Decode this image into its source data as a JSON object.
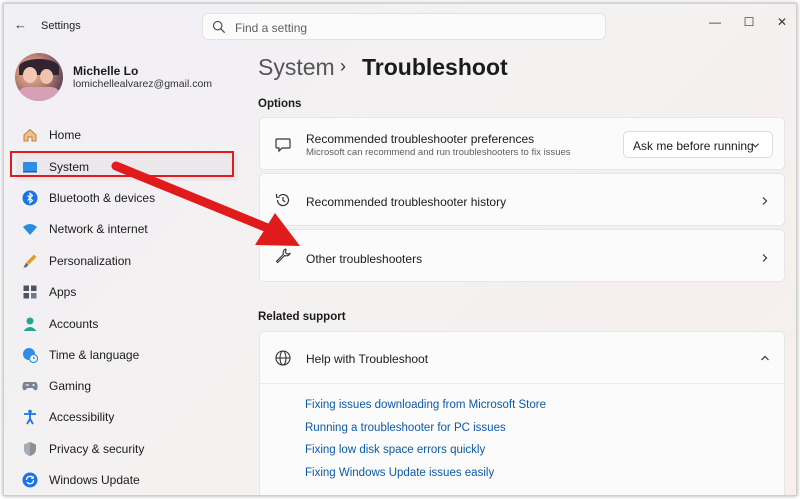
{
  "window": {
    "title": "Settings",
    "minimize_glyph": "—",
    "maximize_glyph": "☐",
    "close_glyph": "✕",
    "back_glyph": "←"
  },
  "search": {
    "placeholder": "Find a setting"
  },
  "profile": {
    "name": "Michelle Lo",
    "email": "lomichellealvarez@gmail.com"
  },
  "sidebar": {
    "items": [
      {
        "label": "Home",
        "icon": "home-icon"
      },
      {
        "label": "System",
        "icon": "monitor-icon",
        "selected": true
      },
      {
        "label": "Bluetooth & devices",
        "icon": "bluetooth-icon"
      },
      {
        "label": "Network & internet",
        "icon": "wifi-icon"
      },
      {
        "label": "Personalization",
        "icon": "brush-icon"
      },
      {
        "label": "Apps",
        "icon": "apps-icon"
      },
      {
        "label": "Accounts",
        "icon": "person-icon"
      },
      {
        "label": "Time & language",
        "icon": "globe-clock-icon"
      },
      {
        "label": "Gaming",
        "icon": "gamepad-icon"
      },
      {
        "label": "Accessibility",
        "icon": "accessibility-icon"
      },
      {
        "label": "Privacy & security",
        "icon": "shield-icon"
      },
      {
        "label": "Windows Update",
        "icon": "update-icon"
      }
    ]
  },
  "breadcrumb": {
    "parent": "System",
    "separator": "›",
    "current": "Troubleshoot"
  },
  "options": {
    "heading": "Options",
    "preferences": {
      "title": "Recommended troubleshooter preferences",
      "subtitle": "Microsoft can recommend and run troubleshooters to fix issues",
      "value": "Ask me before running"
    },
    "history": {
      "title": "Recommended troubleshooter history"
    },
    "other": {
      "title": "Other troubleshooters"
    }
  },
  "related": {
    "heading": "Related support",
    "help_title": "Help with Troubleshoot",
    "links": [
      "Fixing issues downloading from Microsoft Store",
      "Running a troubleshooter for PC issues",
      "Fixing low disk space errors quickly",
      "Fixing Windows Update issues easily"
    ]
  },
  "colors": {
    "accent": "#0067c0",
    "annotation": "#e11b1b",
    "link": "#0d5aa7"
  }
}
